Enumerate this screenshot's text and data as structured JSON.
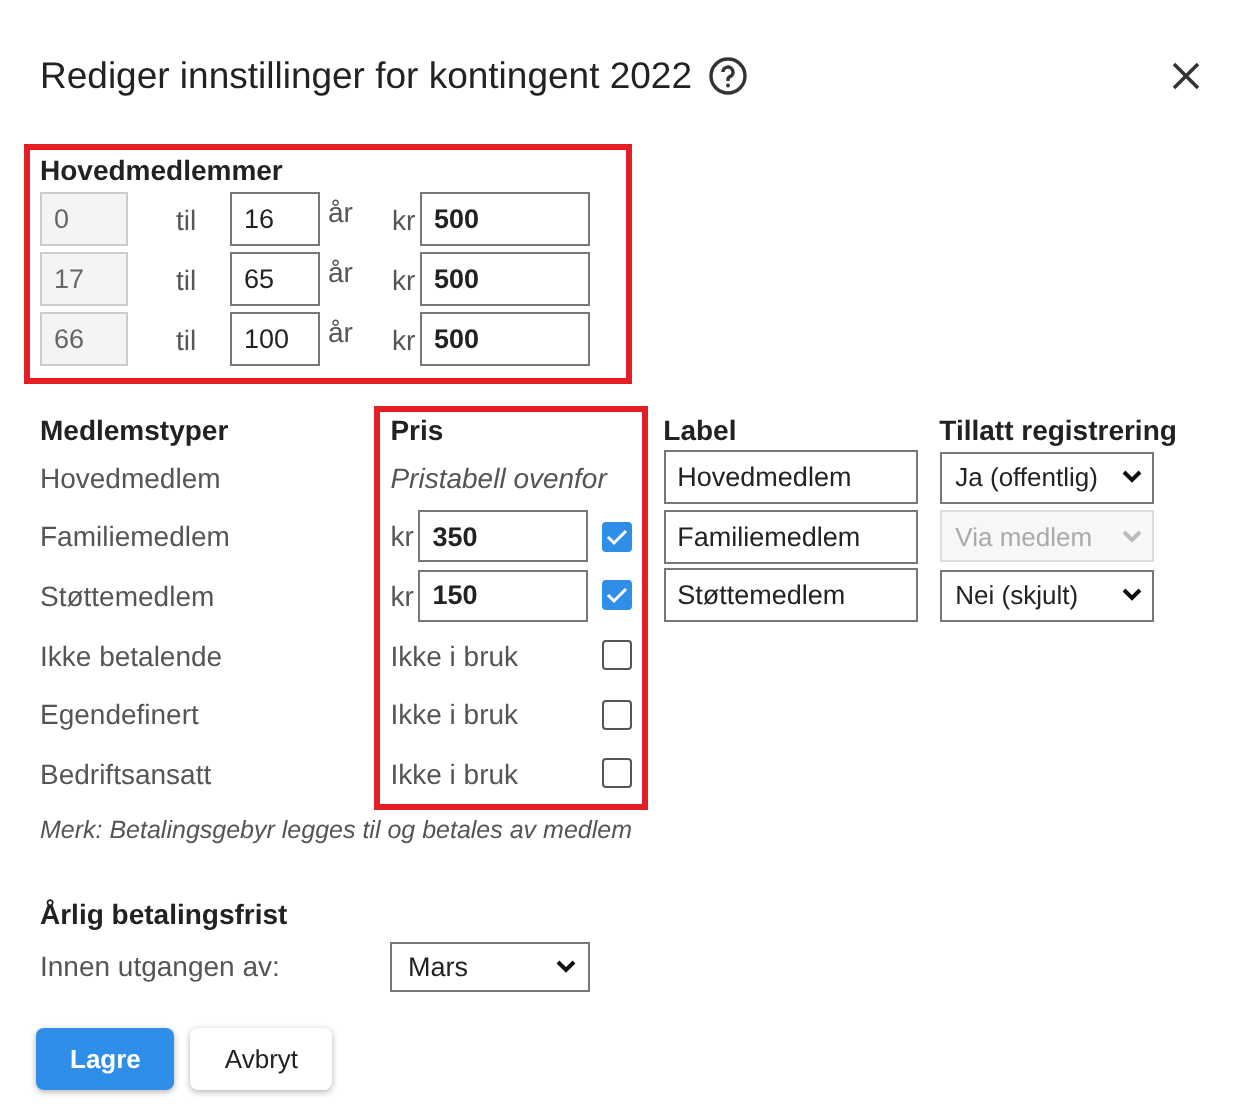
{
  "dialog": {
    "title": "Rediger innstillinger for kontingent 2022"
  },
  "age_groups": {
    "heading": "Hovedmedlemmer",
    "highlighted": true,
    "rows": [
      {
        "from": "0",
        "til": "til",
        "to": "16",
        "unit": "år",
        "currency": "kr",
        "price": "500"
      },
      {
        "from": "17",
        "til": "til",
        "to": "65",
        "unit": "år",
        "currency": "kr",
        "price": "500"
      },
      {
        "from": "66",
        "til": "til",
        "to": "100",
        "unit": "år",
        "currency": "kr",
        "price": "500"
      }
    ]
  },
  "member_types": {
    "columns": [
      "Medlemstyper",
      "Pris",
      "Label",
      "Tillatt registrering"
    ],
    "price_highlighted": true,
    "rows": [
      {
        "name": "Hovedmedlem",
        "kind": "table",
        "price_text": "Pristabell ovenfor",
        "label": "Hovedmedlem",
        "registration": {
          "value": "Ja (offentlig)",
          "disabled": false
        }
      },
      {
        "name": "Familiemedlem",
        "kind": "price",
        "currency": "kr",
        "price": "350",
        "checked": true,
        "label": "Familiemedlem",
        "registration": {
          "value": "Via medlem",
          "disabled": true
        }
      },
      {
        "name": "Støttemedlem",
        "kind": "price",
        "currency": "kr",
        "price": "150",
        "checked": true,
        "label": "Støttemedlem",
        "registration": {
          "value": "Nei (skjult)",
          "disabled": false
        }
      },
      {
        "name": "Ikke betalende",
        "kind": "unused",
        "price_text": "Ikke i bruk",
        "checked": false
      },
      {
        "name": "Egendefinert",
        "kind": "unused",
        "price_text": "Ikke i bruk",
        "checked": false
      },
      {
        "name": "Bedriftsansatt",
        "kind": "unused",
        "price_text": "Ikke i bruk",
        "checked": false
      }
    ]
  },
  "note": "Merk: Betalingsgebyr legges til og betales av medlem",
  "deadline": {
    "heading": "Årlig betalingsfrist",
    "label": "Innen utgangen av:",
    "value": "Mars"
  },
  "buttons": [
    {
      "label": "Lagre",
      "kind": "primary"
    },
    {
      "label": "Avbryt",
      "kind": "secondary"
    }
  ]
}
